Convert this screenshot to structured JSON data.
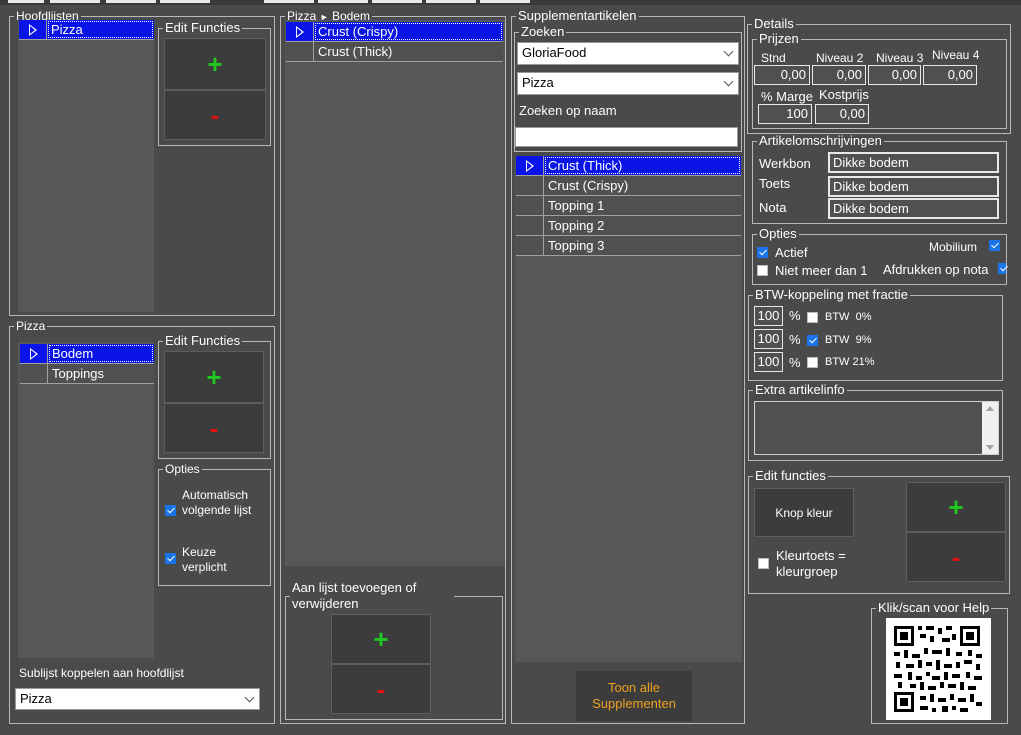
{
  "hoofdlijsten": {
    "title": "Hoofdlijsten",
    "items": [
      {
        "label": "Pizza"
      }
    ]
  },
  "edit_functies_1": {
    "title": "Edit Functies"
  },
  "pizza_group": {
    "title": "Pizza",
    "items": [
      {
        "label": "Bodem"
      },
      {
        "label": "Toppings"
      }
    ]
  },
  "edit_functies_2": {
    "title": "Edit Functies"
  },
  "opties_left": {
    "title": "Opties",
    "auto_label": "Automatisch volgende lijst",
    "keuze_label": "Keuze verplicht",
    "auto_checked": true,
    "keuze_checked": true
  },
  "sublijst": {
    "label": "Sublijst koppelen aan hoofdlijst",
    "value": "Pizza"
  },
  "middle": {
    "title_part1": "Pizza",
    "title_part2": "Bodem",
    "items": [
      {
        "label": "Crust (Crispy)"
      },
      {
        "label": "Crust (Thick)"
      }
    ]
  },
  "aan_lijst": {
    "title": "Aan lijst toevoegen of verwijderen"
  },
  "supplement": {
    "title": "Supplementartikelen",
    "zoeken_title": "Zoeken",
    "combo1": "GloriaFood",
    "combo2": "Pizza",
    "zoeken_op_naam": "Zoeken op naam",
    "search_value": "",
    "items": [
      {
        "label": "Crust (Thick)"
      },
      {
        "label": "Crust (Crispy)"
      },
      {
        "label": "Topping 1"
      },
      {
        "label": "Topping 2"
      },
      {
        "label": "Topping 3"
      }
    ],
    "toon_alle": "Toon alle Supplementen"
  },
  "details": {
    "title": "Details",
    "prijzen": {
      "title": "Prijzen",
      "stnd": "Stnd",
      "niveau2": "Niveau 2",
      "niveau3": "Niveau 3",
      "niveau4": "Niveau 4",
      "v_stnd": "0,00",
      "v_n2": "0,00",
      "v_n3": "0,00",
      "v_n4": "0,00",
      "marge_label": "% Marge",
      "kostprijs_label": "Kostprijs",
      "v_marge": "100",
      "v_kostprijs": "0,00"
    },
    "artikel": {
      "title": "Artikelomschrijvingen",
      "werkbon": "Werkbon",
      "toets": "Toets",
      "nota": "Nota",
      "v_werkbon": "Dikke bodem",
      "v_toets": "Dikke bodem",
      "v_nota": "Dikke bodem"
    },
    "opties": {
      "title": "Opties",
      "actief": "Actief",
      "niet_meer": "Niet meer dan 1",
      "mobilium": "Mobilium",
      "afdrukken": "Afdrukken op nota",
      "actief_checked": true,
      "niet_meer_checked": false,
      "mobilium_checked": true,
      "afdrukken_checked": true
    },
    "btw": {
      "title": "BTW-koppeling met fractie",
      "rows": [
        {
          "value": "100",
          "pct": "%",
          "label": "BTW",
          "rate": "0%",
          "checked": false
        },
        {
          "value": "100",
          "pct": "%",
          "label": "BTW",
          "rate": "9%",
          "checked": true
        },
        {
          "value": "100",
          "pct": "%",
          "label": "BTW",
          "rate": "21%",
          "checked": false
        }
      ]
    },
    "extra": {
      "title": "Extra artikelinfo",
      "value": ""
    },
    "edit": {
      "title": "Edit functies",
      "knop_kleur": "Knop kleur",
      "kleurtoets": "Kleurtoets = kleurgroep",
      "kleurtoets_checked": false
    },
    "help": {
      "title": "Klik/scan voor Help"
    }
  },
  "colors": {
    "background": "#4a4a4a",
    "selection": "#0a14e6",
    "plus": "#1ec81e",
    "minus": "#e01010",
    "accent_text": "#f0a020"
  }
}
